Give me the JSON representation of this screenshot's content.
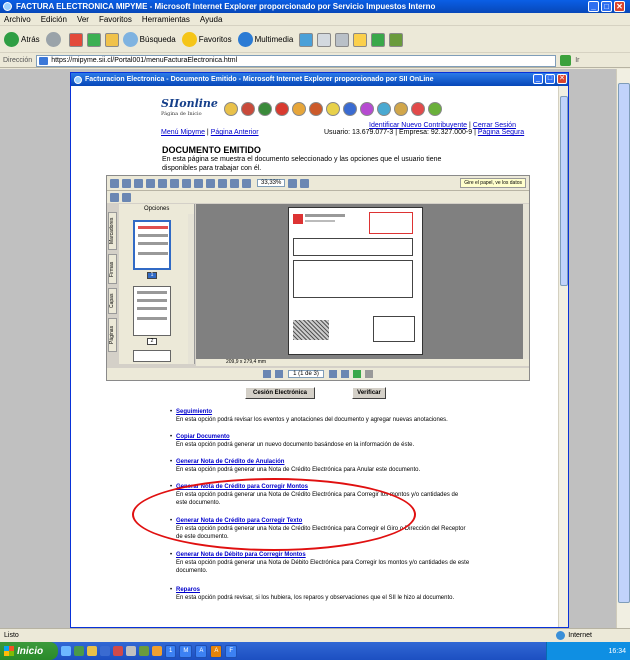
{
  "window": {
    "title": "FACTURA ELECTRONICA MIPYME - Microsoft Internet Explorer proporcionado por Servicio Impuestos Interno"
  },
  "menu": [
    "Archivo",
    "Edición",
    "Ver",
    "Favoritos",
    "Herramientas",
    "Ayuda"
  ],
  "toolbar": {
    "back": "Atrás",
    "search": "Búsqueda",
    "favorites": "Favoritos",
    "media": "Multimedia"
  },
  "address": {
    "label": "Dirección",
    "url": "https://mipyme.sii.cl/Portal001/menuFacturaElectronica.html",
    "links": "Ir"
  },
  "popup": {
    "title": "Facturacion Electronica - Documento Emitido - Microsoft Internet Explorer proporcionado por SII OnLine",
    "logo": "SIIonline",
    "logo_sub": "Página de Inicio",
    "nav_menu": "Menú Mipyme",
    "nav_prev": "Página Anterior",
    "identify": "Identificar Nuevo Contribuyente",
    "logout": "Cerrar Sesión",
    "user_line": "Usuario: 13.679.077-3 | Empresa: 92.327.000-9 |",
    "secure": "Página Segura",
    "doc_title": "DOCUMENTO EMITIDO",
    "doc_desc": "En esta página se muestra el documento seleccionado y las opciones que el usuario tiene disponibles para trabajar con él."
  },
  "pdf": {
    "zoom": "33,33%",
    "tip": "Gire el papel, ve los datos",
    "options": "Opciones",
    "tabs": [
      "Marcadores",
      "Firmas",
      "Capas",
      "Páginas"
    ],
    "thumb_pages": [
      "1",
      "2"
    ],
    "page_size": "209,9 x 279,4 mm",
    "page_indicator": "1 (1 de 3)"
  },
  "buttons": {
    "cesion": "Cesión Electrónica",
    "verificar": "Verificar"
  },
  "options": [
    {
      "title": "Seguimiento",
      "desc": "En esta opción podrá revisar los eventos y anotaciones del documento y agregar nuevas anotaciones."
    },
    {
      "title": "Copiar Documento",
      "desc": "En esta opción podrá generar un nuevo documento basándose en la información de éste."
    },
    {
      "title": "Generar Nota de Crédito de Anulación",
      "desc": "En esta opción podrá generar una Nota de Crédito Electrónica para Anular este documento."
    },
    {
      "title": "Generar Nota de Crédito para Corregir Montos",
      "desc": "En esta opción podrá generar una Nota de Crédito Electrónica para Corregir los montos y/o cantidades de este documento."
    },
    {
      "title": "Generar Nota de Crédito para Corregir Texto",
      "desc": "En esta opción podrá generar una Nota de Crédito Electrónica para Corregir el Giro o Dirección del Receptor de este documento."
    },
    {
      "title": "Generar Nota de Débito para Corregir Montos",
      "desc": "En esta opción podrá generar una Nota de Débito Electrónica para Corregir los montos y/o cantidades de este documento."
    },
    {
      "title": "Reparos",
      "desc": "En esta opción podrá revisar, si los hubiera, los reparos y observaciones que el SII le hizo al documento."
    }
  ],
  "status": {
    "text": "Listo",
    "zone": "Internet"
  },
  "taskbar": {
    "start": "Inicio",
    "tasks": [
      "1",
      "M",
      "A",
      "A",
      "F"
    ],
    "clock": "16:34"
  },
  "colors": {
    "ellipse": "#e01010",
    "link": "#0000cc"
  }
}
